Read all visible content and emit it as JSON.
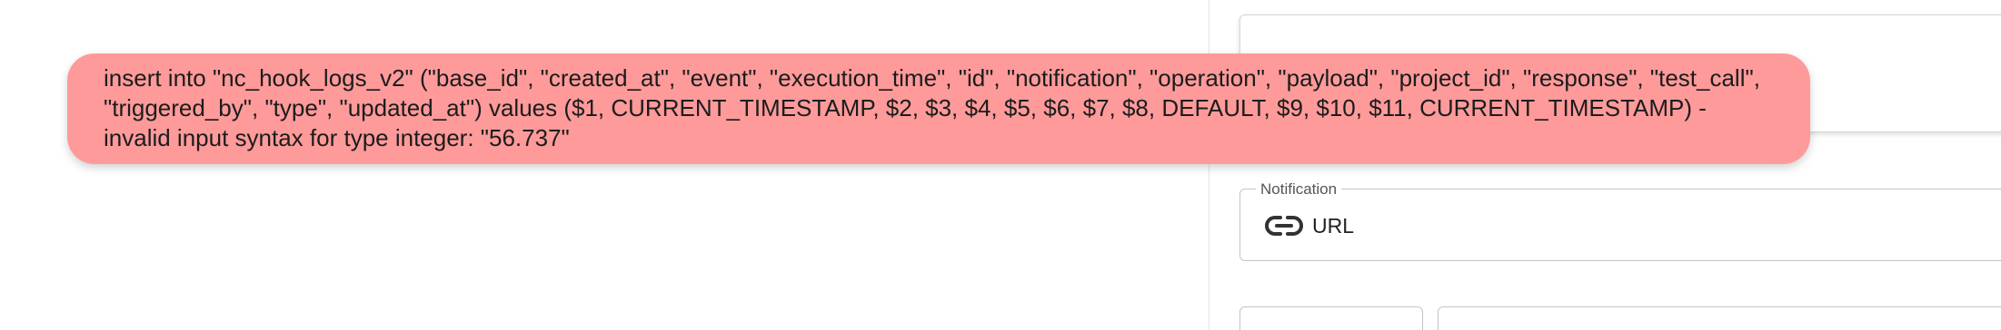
{
  "error_toast": {
    "message": "insert into \"nc_hook_logs_v2\" (\"base_id\", \"created_at\", \"event\", \"execution_time\", \"id\", \"notification\", \"operation\", \"payload\", \"project_id\", \"response\", \"test_call\", \"triggered_by\", \"type\", \"updated_at\") values ($1, CURRENT_TIMESTAMP, $2, $3, $4, $5, $6, $7, $8, DEFAULT, $9, $10, $11, CURRENT_TIMESTAMP) - invalid input syntax for type integer: \"56.737\"",
    "background_color": "#ff9a9a"
  },
  "side_panel": {
    "notification_field": {
      "label": "Notification",
      "value": "URL",
      "icon": "link-icon"
    }
  }
}
